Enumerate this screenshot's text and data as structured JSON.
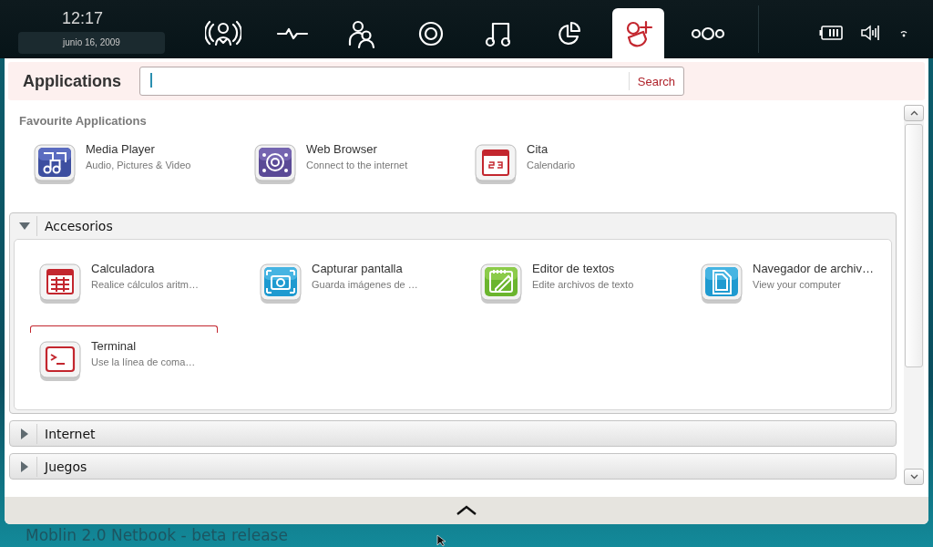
{
  "top_bar": {
    "time": "12:17",
    "date": "junio 16, 2009",
    "nav": [
      {
        "selected": false
      },
      {
        "selected": false
      },
      {
        "selected": false
      },
      {
        "selected": false
      },
      {
        "selected": false
      },
      {
        "selected": false
      },
      {
        "selected": true
      },
      {
        "selected": false
      }
    ]
  },
  "panel": {
    "title": "Applications",
    "search_button": "Search",
    "favourites": {
      "heading": "Favourite Applications",
      "items": [
        {
          "name": "Media Player",
          "description": "Audio, Pictures & Video"
        },
        {
          "name": "Web Browser",
          "description": "Connect to the internet"
        },
        {
          "name": "Cita",
          "description": "Calendario"
        }
      ]
    },
    "sections": [
      {
        "title": "Accesorios",
        "expanded": true,
        "items": [
          {
            "name": "Calculadora",
            "description": "Realice cálculos aritm…"
          },
          {
            "name": "Capturar pantalla",
            "description": "Guarda imágenes de …"
          },
          {
            "name": "Editor de textos",
            "description": "Edite archivos de texto"
          },
          {
            "name": "Navegador de archiv…",
            "description": "View your computer"
          },
          {
            "name": "Terminal",
            "description": "Use la línea de coma…"
          }
        ]
      },
      {
        "title": "Internet",
        "expanded": false
      },
      {
        "title": "Juegos",
        "expanded": false
      }
    ]
  },
  "desktop_caption": "Moblin 2.0 Netbook - beta release"
}
